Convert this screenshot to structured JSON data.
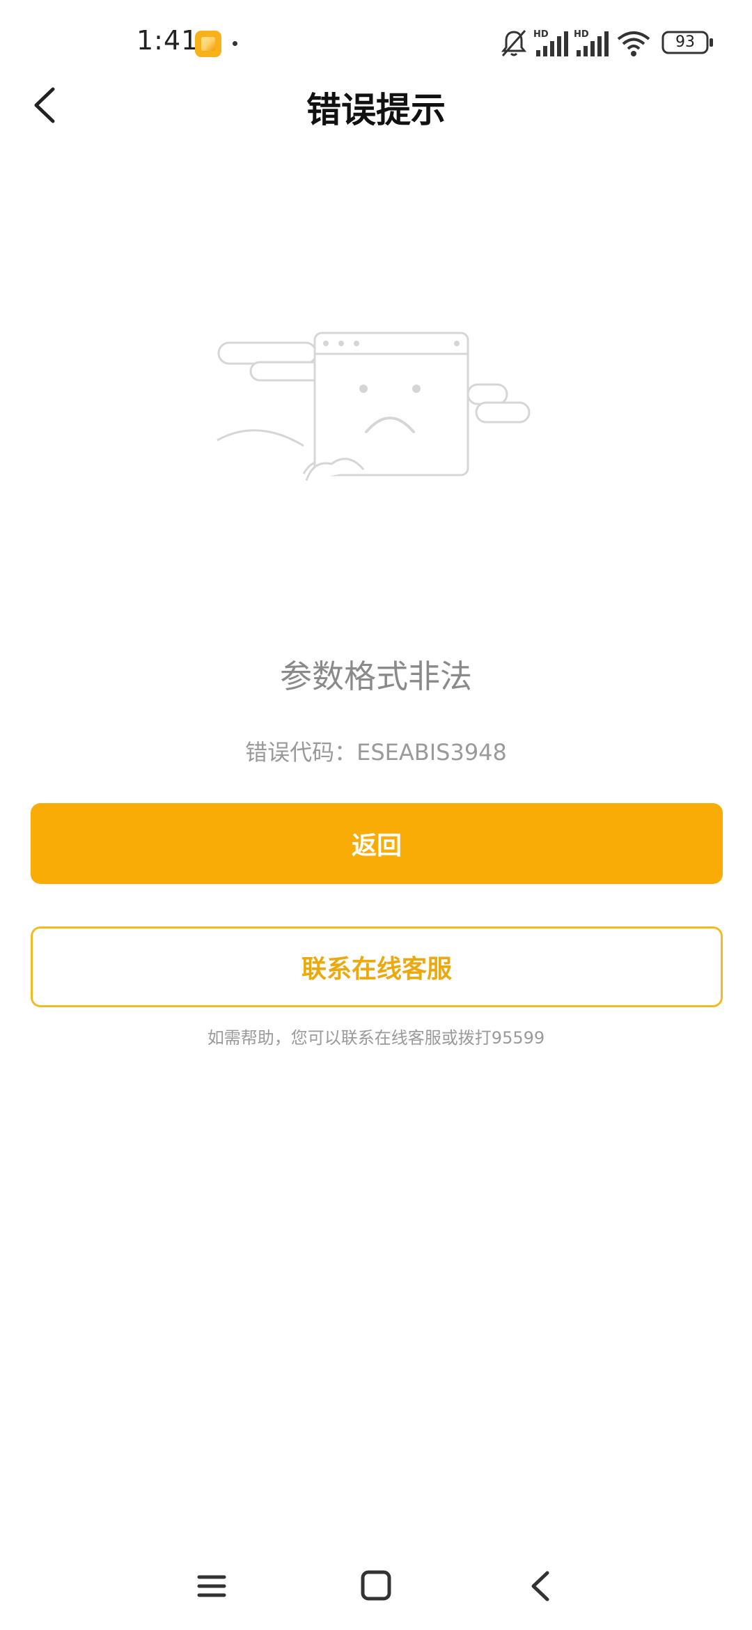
{
  "status_bar": {
    "time": "1:41",
    "battery_level": "93",
    "network_badges": [
      "HD",
      "HD"
    ],
    "icons": [
      "app-notification-icon",
      "dot-icon",
      "mute-bell-icon",
      "signal-icon",
      "signal-icon",
      "wifi-icon",
      "battery-icon"
    ]
  },
  "header": {
    "title": "错误提示",
    "back_icon": "chevron-left-icon"
  },
  "error": {
    "illustration_icon": "sad-browser-window-icon",
    "message": "参数格式非法",
    "code_label": "错误代码：",
    "code_value": "ESEABIS3948"
  },
  "actions": {
    "primary_label": "返回",
    "secondary_label": "联系在线客服",
    "help_text": "如需帮助，您可以联系在线客服或拨打95599"
  },
  "system_nav": {
    "icons": [
      "menu-icon",
      "home-square-icon",
      "back-triangle-icon"
    ]
  },
  "colors": {
    "accent": "#f9ab06",
    "accent_border": "#f2bb24",
    "accent_text": "#eaa90e",
    "muted_text": "#9a9a9a"
  }
}
